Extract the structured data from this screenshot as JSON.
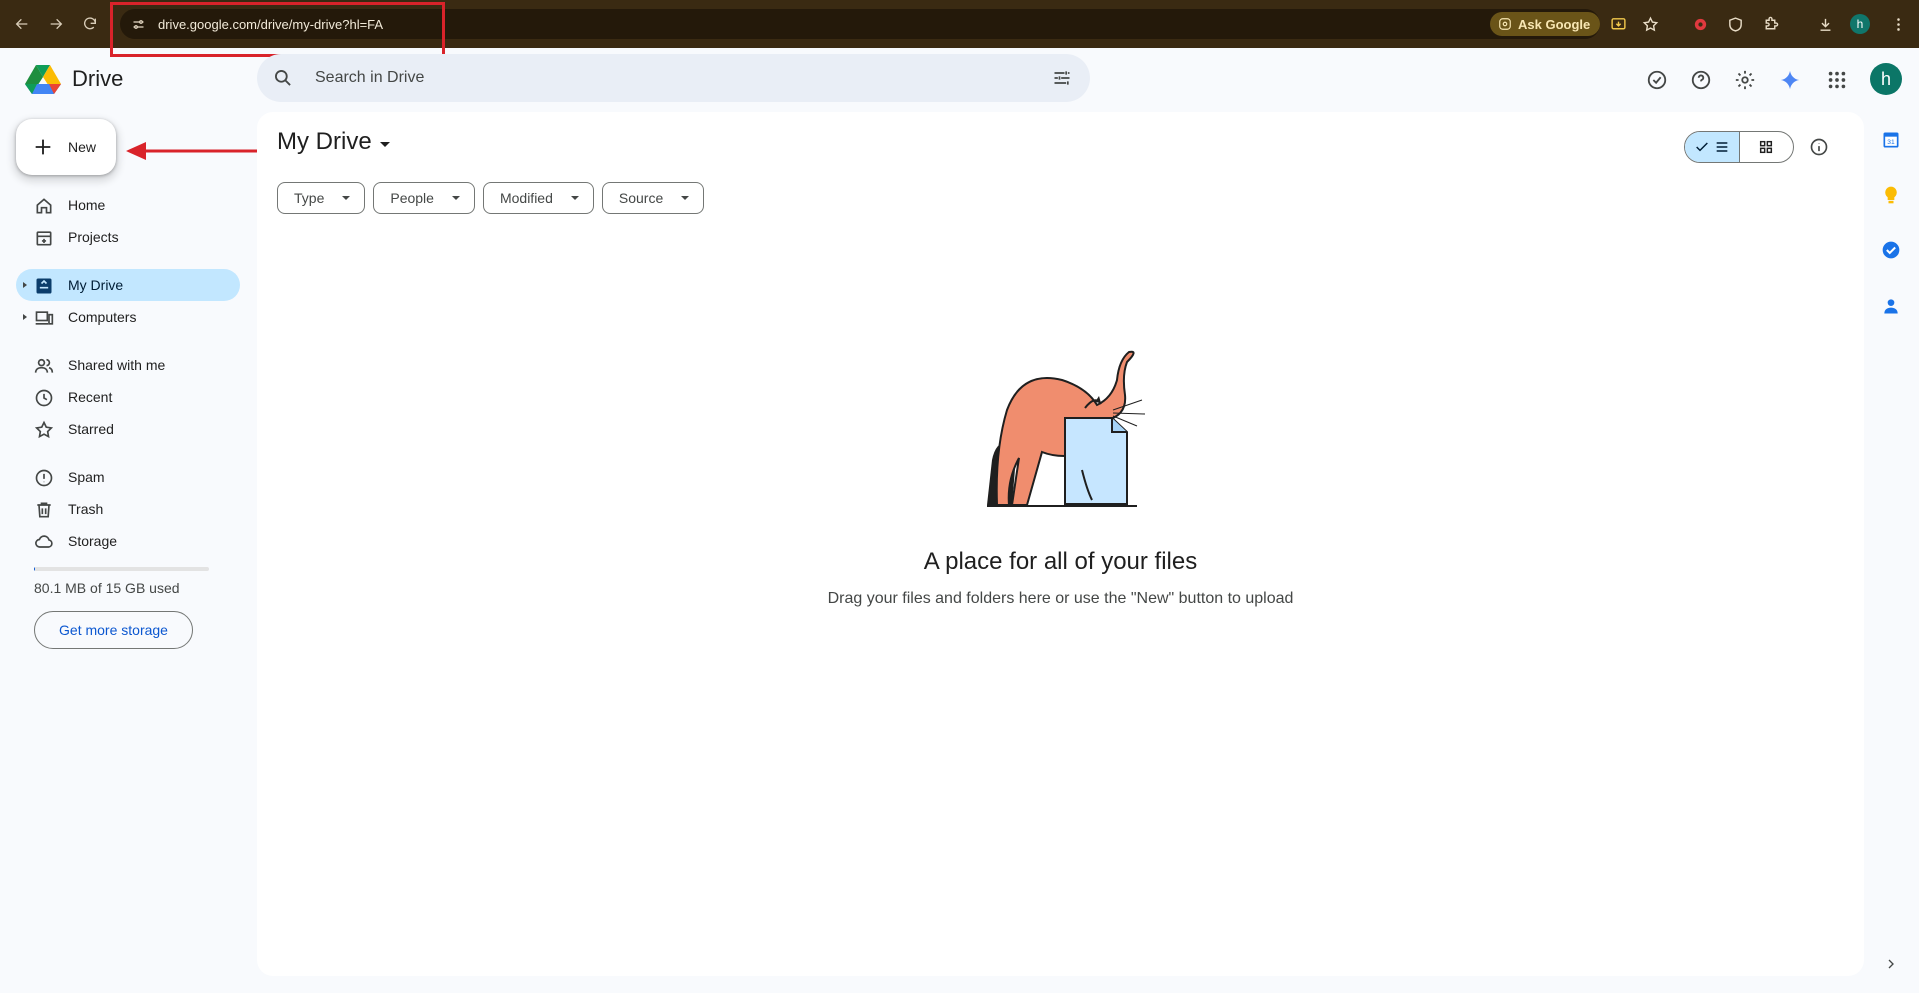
{
  "browser": {
    "url": "drive.google.com/drive/my-drive?hl=FA",
    "ask_google": "Ask Google",
    "profile_initial": "h"
  },
  "app": {
    "name": "Drive",
    "search_placeholder": "Search in Drive",
    "avatar_initial": "h"
  },
  "sidebar": {
    "new_label": "New",
    "items": [
      {
        "label": "Home",
        "icon": "home-icon"
      },
      {
        "label": "Projects",
        "icon": "projects-icon"
      },
      {
        "label": "My Drive",
        "icon": "my-drive-icon",
        "active": true
      },
      {
        "label": "Computers",
        "icon": "computers-icon"
      },
      {
        "label": "Shared with me",
        "icon": "shared-icon"
      },
      {
        "label": "Recent",
        "icon": "clock-icon"
      },
      {
        "label": "Starred",
        "icon": "star-icon"
      },
      {
        "label": "Spam",
        "icon": "spam-icon"
      },
      {
        "label": "Trash",
        "icon": "trash-icon"
      },
      {
        "label": "Storage",
        "icon": "cloud-icon"
      }
    ],
    "storage_used_fraction": 0.0053,
    "storage_text": "80.1 MB of 15 GB used",
    "more_storage_label": "Get more storage"
  },
  "main": {
    "title": "My Drive",
    "filters": [
      "Type",
      "People",
      "Modified",
      "Source"
    ],
    "empty_title": "A place for all of your files",
    "empty_subtitle": "Drag your files and folders here or use the \"New\" button to upload"
  },
  "colors": {
    "accent": "#0b57d0",
    "active_nav": "#c2e7ff",
    "annotation": "#d9232a"
  }
}
